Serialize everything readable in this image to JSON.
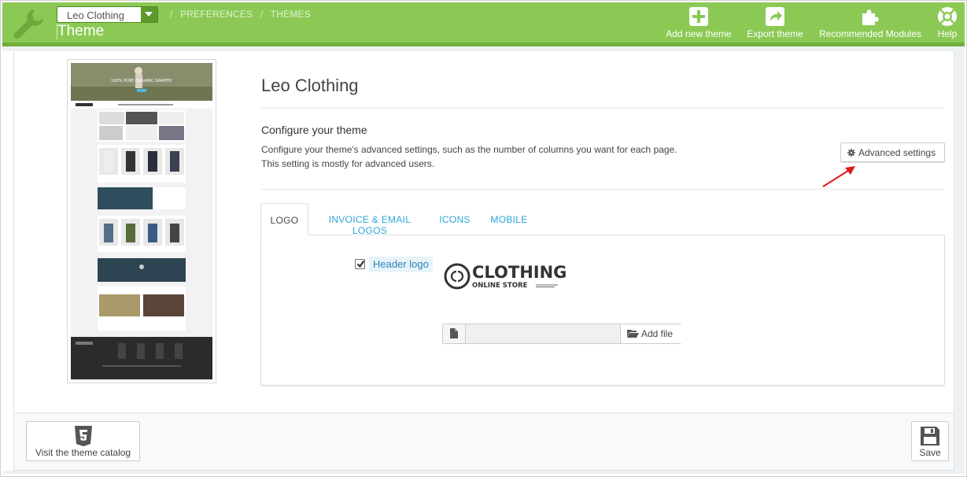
{
  "header": {
    "store_select": "Leo Clothing",
    "breadcrumbs": [
      "PREFERENCES",
      "THEMES"
    ],
    "breadcrumb_sep": "/",
    "page_title": "Theme",
    "toolbar": {
      "add_new_theme": "Add new theme",
      "export_theme": "Export theme",
      "recommended_modules": "Recommended Modules",
      "help": "Help"
    },
    "colors": {
      "bar": "#8bc954",
      "bar_dark": "#6fae3a"
    }
  },
  "theme": {
    "name": "Leo Clothing",
    "configure_title": "Configure your theme",
    "configure_desc_1": "Configure your theme's advanced settings, such as the number of columns you want for each page.",
    "configure_desc_2": "This setting is mostly for advanced users.",
    "advanced_settings": "Advanced settings"
  },
  "preview": {
    "banner_text": "100% PURE ORGANIC GRAPES!"
  },
  "tabs": [
    {
      "label": "LOGO",
      "active": true
    },
    {
      "label": "INVOICE & EMAIL LOGOS",
      "active": false
    },
    {
      "label": "ICONS",
      "active": false
    },
    {
      "label": "MOBILE",
      "active": false
    }
  ],
  "logo_tab": {
    "header_logo_label": "Header logo",
    "header_logo_checked": true,
    "logo_brand": "CLOTHING",
    "logo_sub": "ONLINE STORE",
    "add_file": "Add file",
    "file_value": ""
  },
  "footer": {
    "catalog_button": "Visit the theme catalog",
    "save_button": "Save"
  }
}
